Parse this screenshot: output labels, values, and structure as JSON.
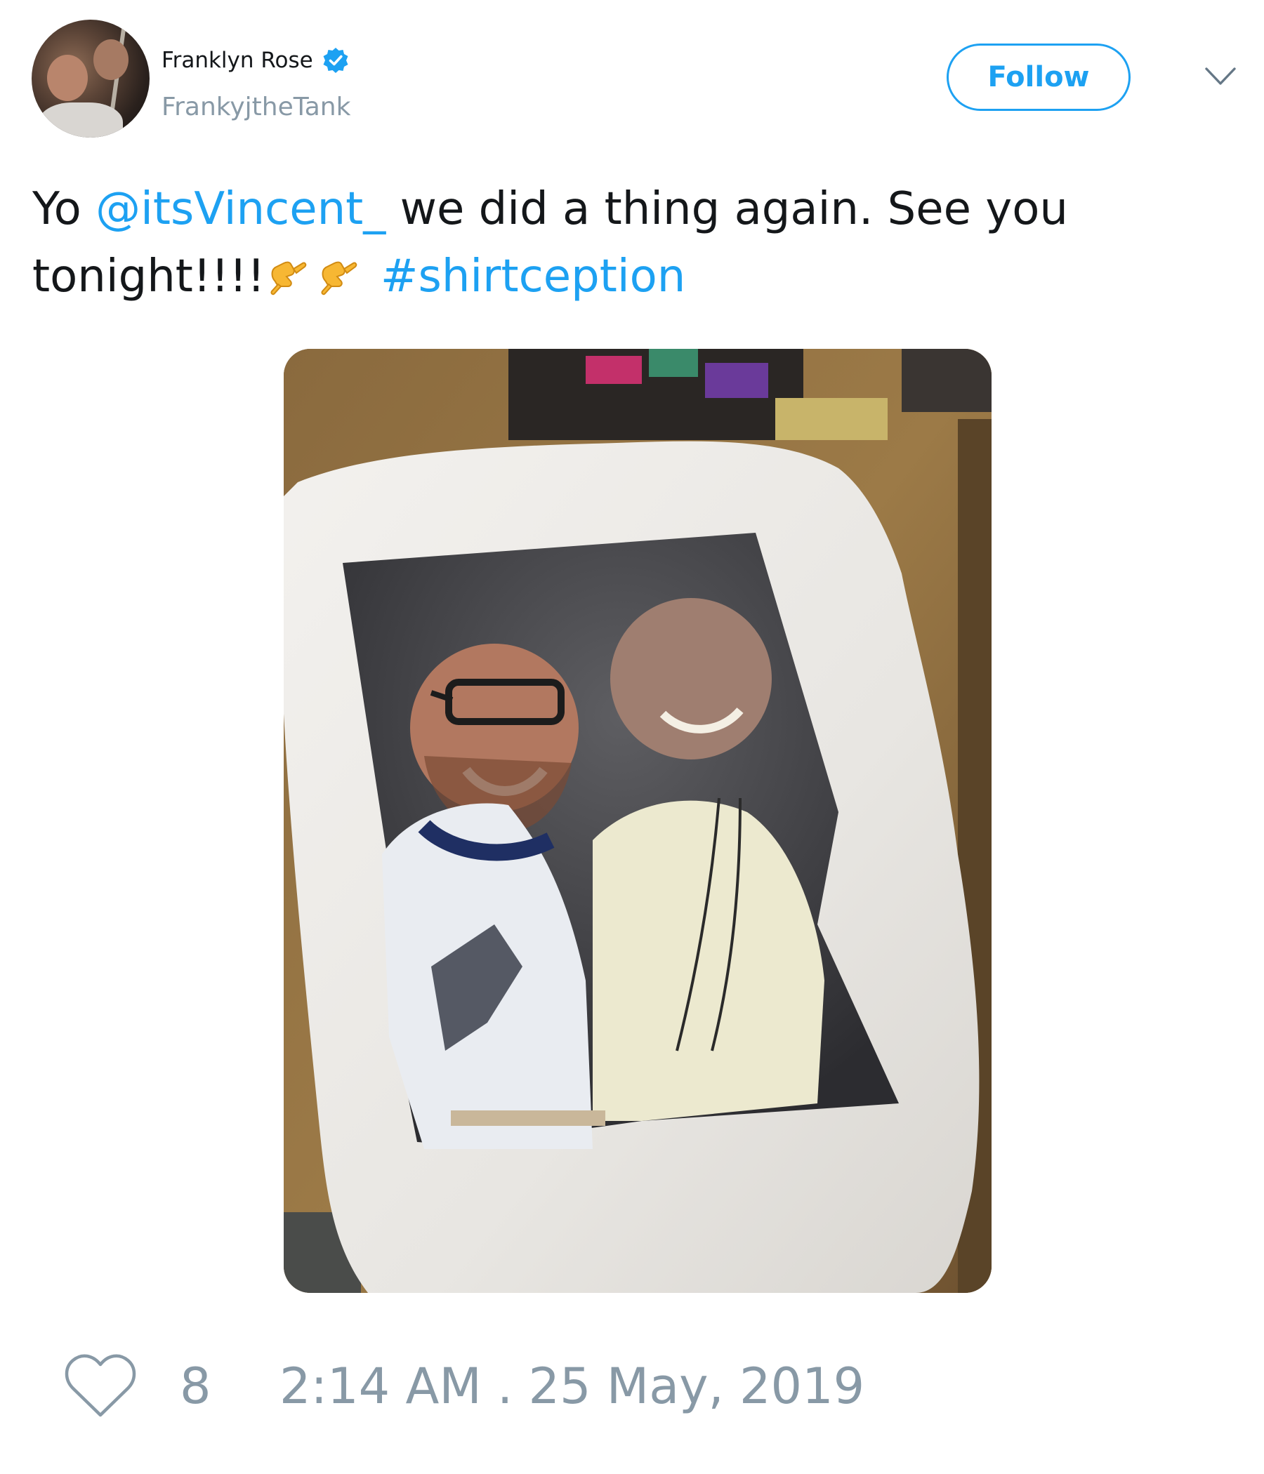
{
  "author": {
    "display_name": "Franklyn Rose",
    "handle": "FrankyjtheTank",
    "verified": true
  },
  "actions": {
    "follow_label": "Follow",
    "menu_icon": "chevron-down-icon"
  },
  "tweet": {
    "text_prefix": "Yo ",
    "mention": "@itsVincent_",
    "text_middle": " we did a thing again. See you tonight!!!!",
    "emoji_name": "call-me-hand-emoji",
    "emoji_count": 2,
    "hashtag": "#shirtception"
  },
  "media": {
    "type": "photo"
  },
  "footer": {
    "like_icon": "heart-icon",
    "like_count": "8",
    "timestamp": "2:14 AM . 25 May, 2019"
  },
  "colors": {
    "link": "#1da1f2",
    "muted": "#8899a6",
    "text": "#14171a"
  }
}
